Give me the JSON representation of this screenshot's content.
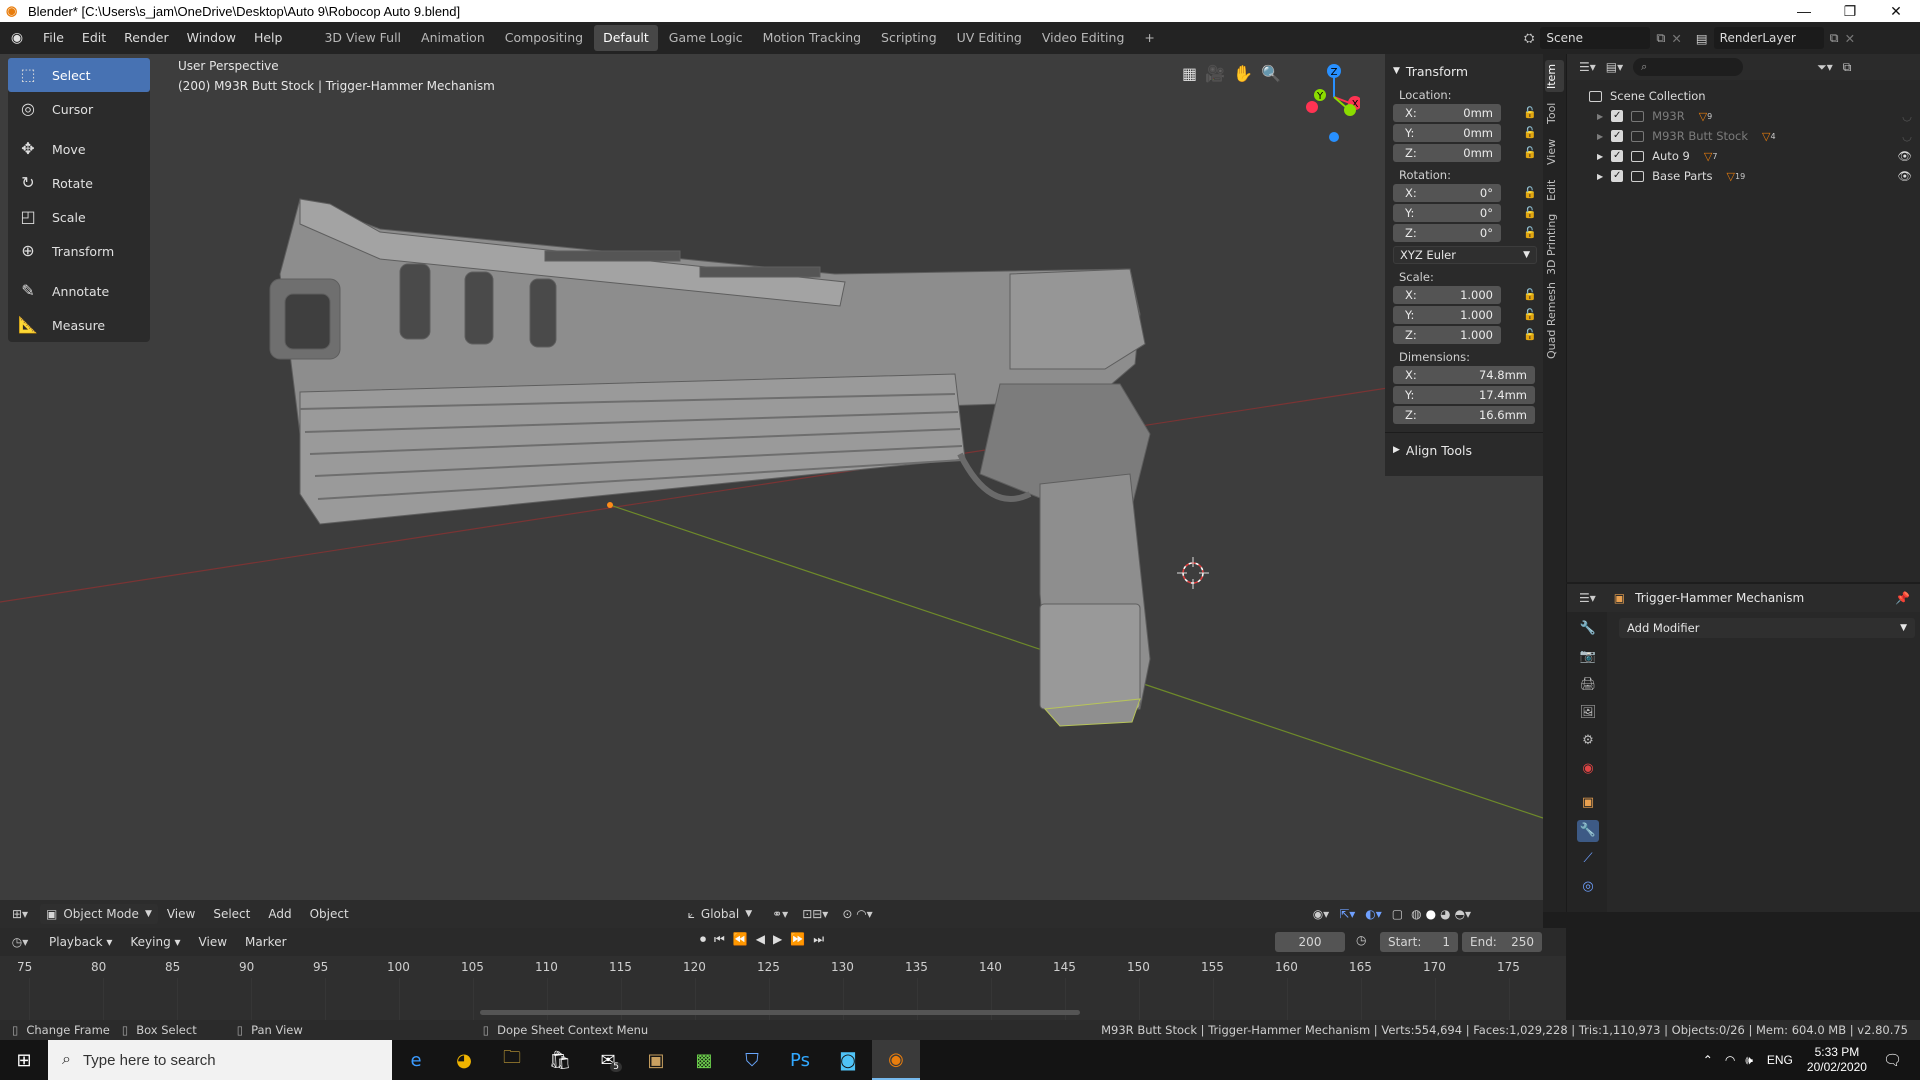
{
  "window": {
    "title": "Blender* [C:\\Users\\s_jam\\OneDrive\\Desktop\\Auto 9\\Robocop Auto 9.blend]",
    "minimize": "—",
    "maximize": "❐",
    "close": "✕"
  },
  "menu": [
    "File",
    "Edit",
    "Render",
    "Window",
    "Help"
  ],
  "workspaces": [
    "3D View Full",
    "Animation",
    "Compositing",
    "Default",
    "Game Logic",
    "Motion Tracking",
    "Scripting",
    "UV Editing",
    "Video Editing"
  ],
  "active_workspace": "Default",
  "add_workspace": "+",
  "scene": {
    "label": "Scene",
    "render_layer": "RenderLayer"
  },
  "tools": [
    {
      "label": "Select",
      "icon": "select-box-icon",
      "active": true
    },
    {
      "label": "Cursor",
      "icon": "cursor-icon"
    },
    {
      "label": "Move",
      "icon": "move-icon"
    },
    {
      "label": "Rotate",
      "icon": "rotate-icon"
    },
    {
      "label": "Scale",
      "icon": "scale-icon"
    },
    {
      "label": "Transform",
      "icon": "transform-icon"
    },
    {
      "label": "Annotate",
      "icon": "annotate-icon"
    },
    {
      "label": "Measure",
      "icon": "measure-icon"
    }
  ],
  "viewport": {
    "perspective": "User Perspective",
    "object_info": "(200) M93R Butt Stock | Trigger-Hammer Mechanism"
  },
  "gizmo": {
    "x": "X",
    "y": "Y",
    "z": "Z"
  },
  "npanel": {
    "transform_title": "Transform",
    "location_label": "Location:",
    "location": [
      {
        "axis": "X:",
        "value": "0mm"
      },
      {
        "axis": "Y:",
        "value": "0mm"
      },
      {
        "axis": "Z:",
        "value": "0mm"
      }
    ],
    "rotation_label": "Rotation:",
    "rotation": [
      {
        "axis": "X:",
        "value": "0°"
      },
      {
        "axis": "Y:",
        "value": "0°"
      },
      {
        "axis": "Z:",
        "value": "0°"
      }
    ],
    "rotation_mode": "XYZ Euler",
    "scale_label": "Scale:",
    "scale": [
      {
        "axis": "X:",
        "value": "1.000"
      },
      {
        "axis": "Y:",
        "value": "1.000"
      },
      {
        "axis": "Z:",
        "value": "1.000"
      }
    ],
    "dimensions_label": "Dimensions:",
    "dimensions": [
      {
        "axis": "X:",
        "value": "74.8mm"
      },
      {
        "axis": "Y:",
        "value": "17.4mm"
      },
      {
        "axis": "Z:",
        "value": "16.6mm"
      }
    ],
    "align_tools": "Align Tools"
  },
  "side_tabs": [
    "Item",
    "Tool",
    "View",
    "Edit",
    "3D Printing",
    "Quad Remesh"
  ],
  "outliner": {
    "root": "Scene Collection",
    "items": [
      {
        "name": "M93R",
        "badge": "9",
        "dim": true
      },
      {
        "name": "M93R Butt Stock",
        "badge": "4",
        "dim": true
      },
      {
        "name": "Auto 9",
        "badge": "7",
        "dim": false
      },
      {
        "name": "Base Parts",
        "badge": "19",
        "dim": false
      }
    ]
  },
  "properties": {
    "object_name": "Trigger-Hammer Mechanism",
    "add_modifier": "Add Modifier"
  },
  "viewport_header": {
    "mode": "Object Mode",
    "menus": [
      "View",
      "Select",
      "Add",
      "Object"
    ],
    "orientation": "Global"
  },
  "timeline": {
    "menus": [
      "Playback",
      "Keying",
      "View",
      "Marker"
    ],
    "current_frame": "200",
    "start_label": "Start:",
    "start": "1",
    "end_label": "End:",
    "end": "250",
    "ticks": [
      "75",
      "80",
      "85",
      "90",
      "95",
      "100",
      "105",
      "110",
      "115",
      "120",
      "125",
      "130",
      "135",
      "140",
      "145",
      "150",
      "155",
      "160",
      "165",
      "170",
      "175"
    ]
  },
  "status": {
    "left": [
      "Change Frame",
      "Box Select",
      "Pan View"
    ],
    "middle": "Dope Sheet Context Menu",
    "right": "M93R Butt Stock | Trigger-Hammer Mechanism | Verts:554,694 | Faces:1,029,228 | Tris:1,110,973 | Objects:0/26 | Mem: 604.0 MB | v2.80.75"
  },
  "taskbar": {
    "search_placeholder": "Type here to search",
    "lang": "ENG",
    "time": "5:33 PM",
    "date": "20/02/2020",
    "mail_badge": "5"
  },
  "colors": {
    "accent": "#4772b3",
    "blender_orange": "#e87d0d",
    "axis_x": "#ff3352",
    "axis_y": "#8bdc00",
    "axis_z": "#2890ff"
  }
}
